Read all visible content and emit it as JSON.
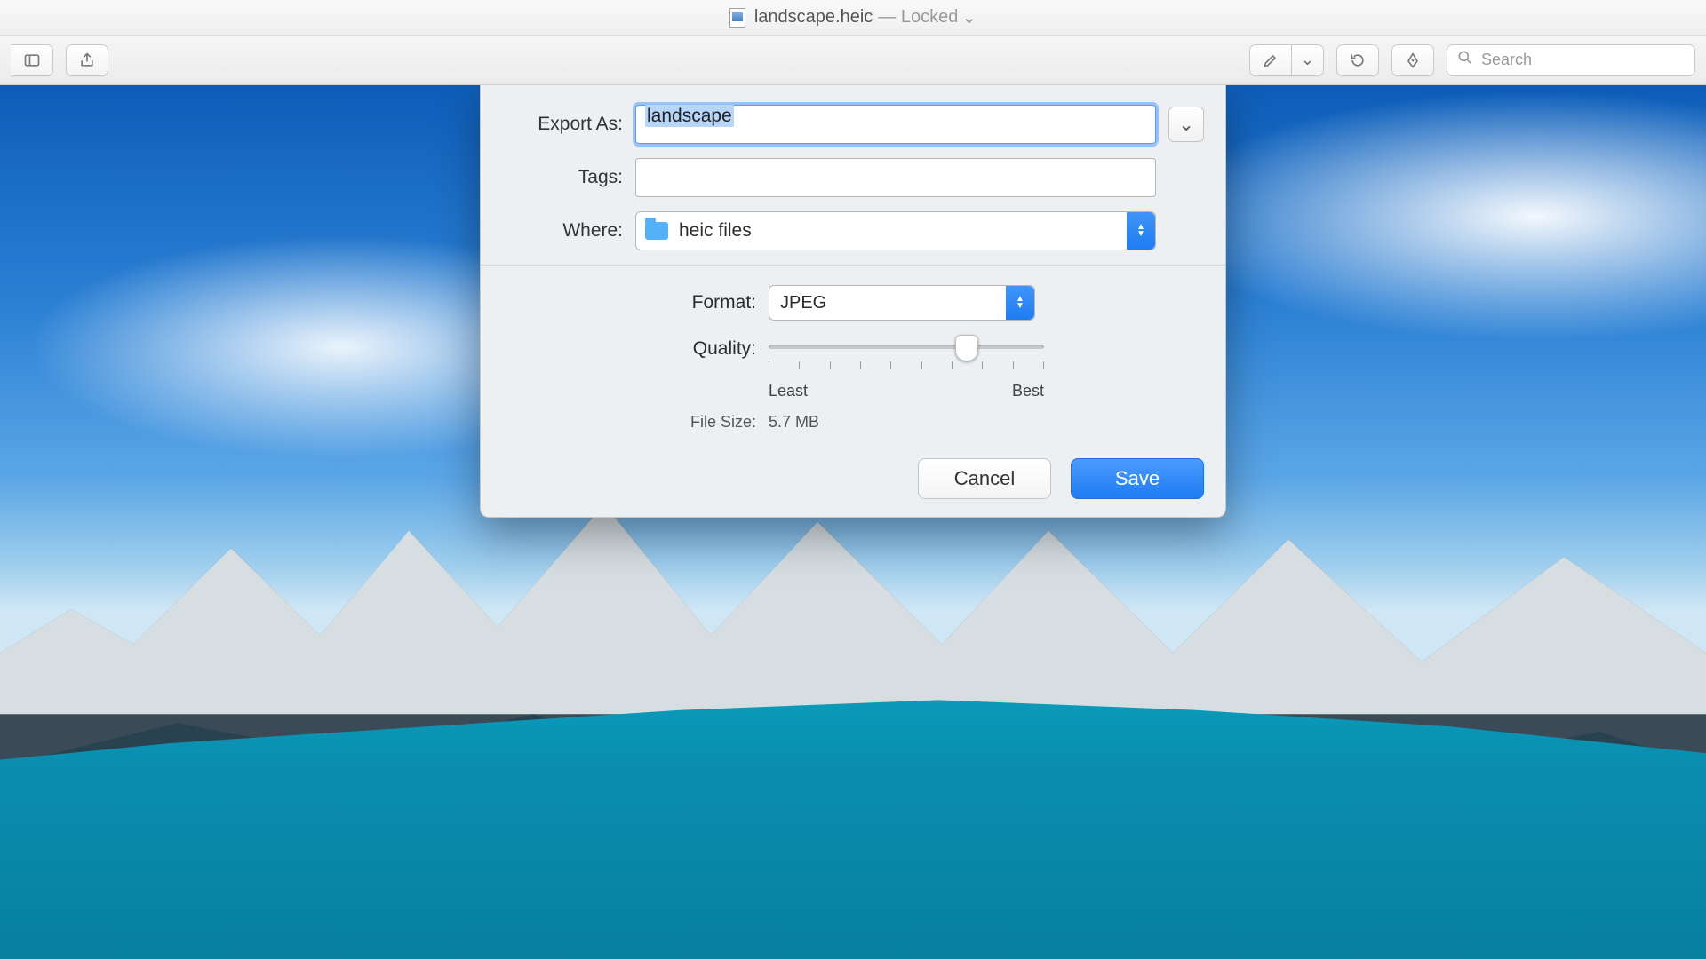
{
  "titlebar": {
    "filename": "landscape.heic",
    "status": "— Locked"
  },
  "toolbar": {
    "search_placeholder": "Search"
  },
  "dialog": {
    "exportAs": {
      "label": "Export As:",
      "value": "landscape"
    },
    "tags": {
      "label": "Tags:",
      "value": ""
    },
    "where": {
      "label": "Where:",
      "value": "heic files"
    },
    "format": {
      "label": "Format:",
      "value": "JPEG"
    },
    "quality": {
      "label": "Quality:",
      "least": "Least",
      "best": "Best",
      "position_pct": 72
    },
    "fileSize": {
      "label": "File Size:",
      "value": "5.7 MB"
    },
    "buttons": {
      "cancel": "Cancel",
      "save": "Save"
    }
  }
}
